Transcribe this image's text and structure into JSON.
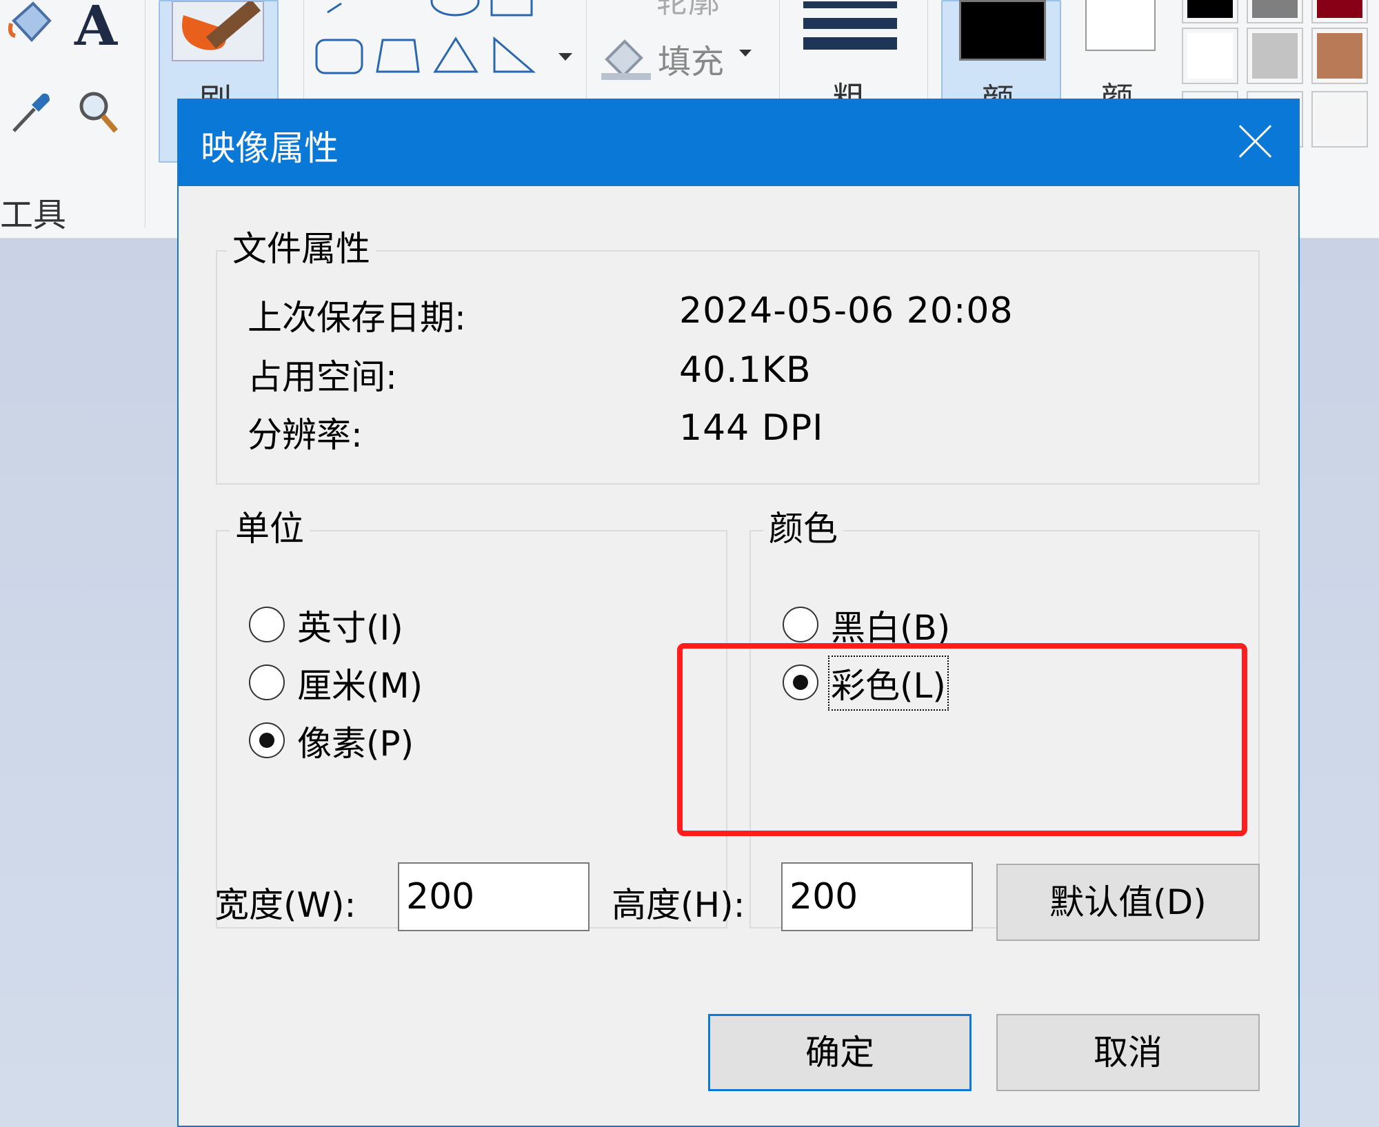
{
  "ribbon": {
    "tools_label": "工具",
    "brush_label": "刷",
    "outline_label": "轮廓",
    "fill_label": "填充",
    "size_label": "粗",
    "color1_label": "颜",
    "color2_label": "颜"
  },
  "dialog": {
    "title": "映像属性",
    "file_props": {
      "legend": "文件属性",
      "rows": [
        {
          "label": "上次保存日期:",
          "value": "2024-05-06 20:08"
        },
        {
          "label": "占用空间:",
          "value": "40.1KB"
        },
        {
          "label": "分辨率:",
          "value": "144 DPI"
        }
      ]
    },
    "units": {
      "legend": "单位",
      "options": [
        {
          "text": "英寸(I)",
          "checked": false
        },
        {
          "text": "厘米(M)",
          "checked": false
        },
        {
          "text": "像素(P)",
          "checked": true
        }
      ]
    },
    "colors": {
      "legend": "颜色",
      "options": [
        {
          "text": "黑白(B)",
          "checked": false
        },
        {
          "text": "彩色(L)",
          "checked": true
        }
      ]
    },
    "width_label": "宽度(W):",
    "width_value": "200",
    "height_label": "高度(H):",
    "height_value": "200",
    "default_button": "默认值(D)",
    "ok_button": "确定",
    "cancel_button": "取消"
  },
  "colors": {
    "titlebar": "#0a78d7",
    "highlight": "#ff1e1e"
  }
}
